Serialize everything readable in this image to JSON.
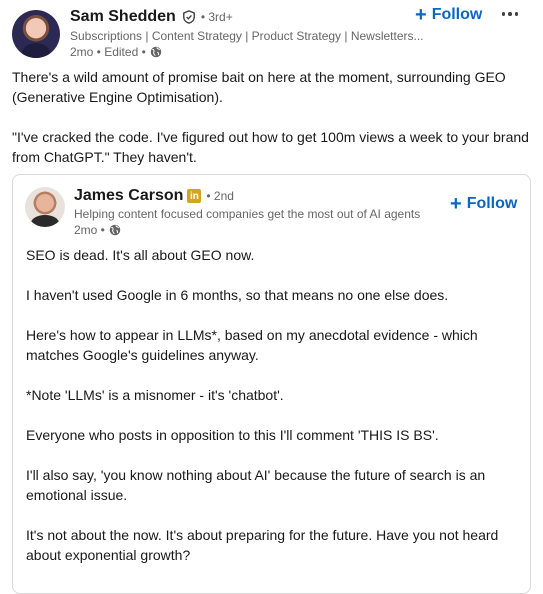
{
  "post": {
    "author_name": "Sam Shedden",
    "verified_icon": "verified-shield-icon",
    "degree": "• 3rd+",
    "headline": "Subscriptions | Content Strategy | Product Strategy | Newsletters...",
    "meta": "2mo • Edited •",
    "globe_icon": "globe-icon",
    "follow_label": "Follow",
    "text": [
      "There's a wild amount of promise bait on here at the moment, surrounding GEO (Generative Engine Optimisation).",
      "\"I've cracked the code. I've figured out how to get 100m views a week to your brand from ChatGPT.\" They haven't."
    ]
  },
  "quoted": {
    "author_name": "James Carson",
    "badge": "in",
    "degree": "• 2nd",
    "headline": "Helping content focused companies get the most out of AI agents",
    "meta": "2mo •",
    "follow_label": "Follow",
    "text": [
      "SEO is dead. It's all about GEO now.",
      "I haven't used Google in 6 months, so that means no one else does.",
      "Here's how to appear in LLMs*, based on my anecdotal evidence - which matches Google's guidelines anyway.",
      "*Note 'LLMs' is a misnomer - it's 'chatbot'.",
      "Everyone who posts in opposition to this I'll comment 'THIS IS BS'.",
      "I'll also say, 'you know nothing about AI' because the future of search is an emotional issue.",
      "It's not about the now. It's about preparing for the future. Have you not heard about exponential growth?"
    ]
  },
  "colors": {
    "accent": "#0a66c2",
    "secondary_text": "#666666",
    "primary_text": "#191919",
    "badge_gold": "#d4a51e"
  }
}
